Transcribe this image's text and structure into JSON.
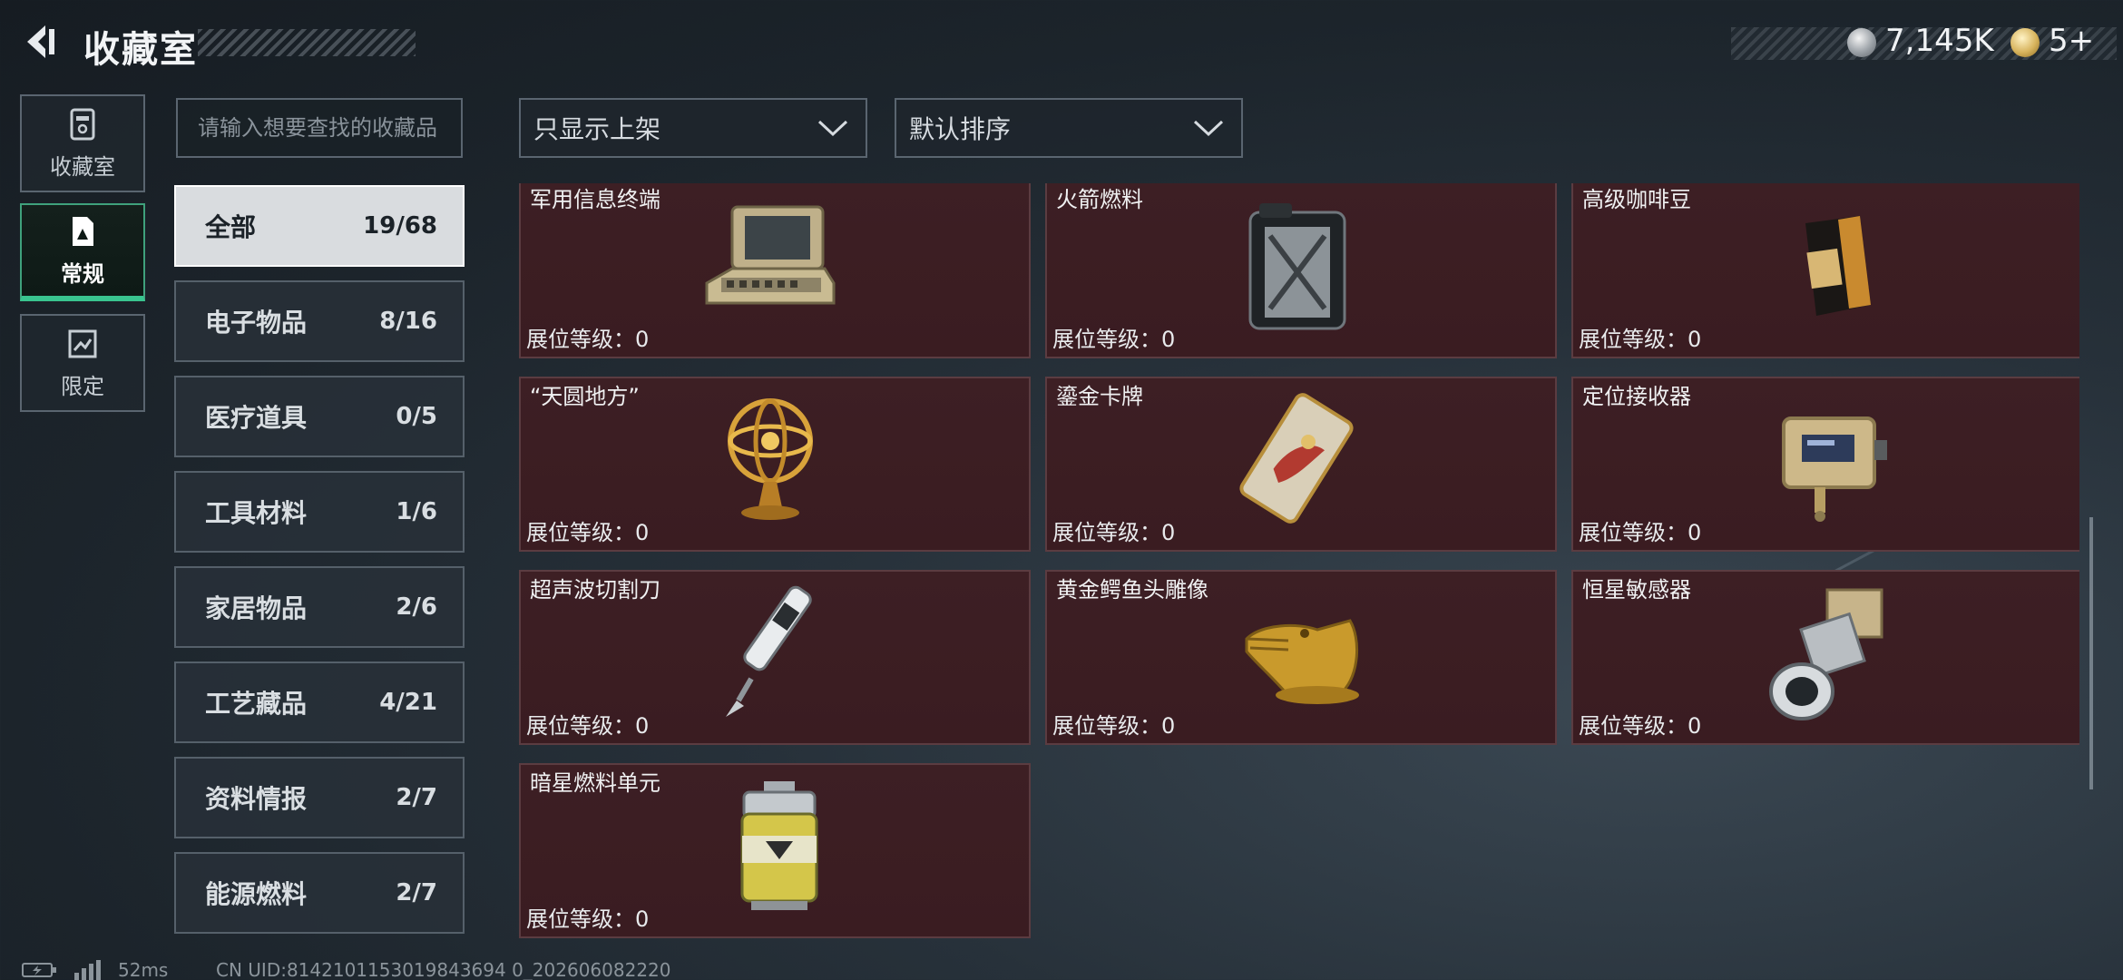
{
  "header": {
    "title": "收藏室"
  },
  "currency": {
    "silver": "7,145K",
    "gold": "5+"
  },
  "side_nav": [
    {
      "label": "收藏室",
      "icon": "collection-box-icon",
      "active": false
    },
    {
      "label": "常规",
      "icon": "regular-doc-icon",
      "active": true
    },
    {
      "label": "限定",
      "icon": "limited-card-icon",
      "active": false
    }
  ],
  "search": {
    "placeholder": "请输入想要查找的收藏品"
  },
  "filters": {
    "shelf": "只显示上架",
    "sort": "默认排序"
  },
  "categories": [
    {
      "name": "全部",
      "count": "19/68",
      "active": true
    },
    {
      "name": "电子物品",
      "count": "8/16"
    },
    {
      "name": "医疗道具",
      "count": "0/5"
    },
    {
      "name": "工具材料",
      "count": "1/6"
    },
    {
      "name": "家居物品",
      "count": "2/6"
    },
    {
      "name": "工艺藏品",
      "count": "4/21"
    },
    {
      "name": "资料情报",
      "count": "2/7"
    },
    {
      "name": "能源燃料",
      "count": "2/7"
    }
  ],
  "items": [
    {
      "name": "军用信息终端",
      "level": "展位等级：0",
      "icon": "military-terminal-icon"
    },
    {
      "name": "火箭燃料",
      "level": "展位等级：0",
      "icon": "fuel-canister-icon"
    },
    {
      "name": "高级咖啡豆",
      "level": "展位等级：0",
      "icon": "coffee-bag-icon"
    },
    {
      "name": "“天圆地方”",
      "level": "展位等级：0",
      "icon": "armillary-sphere-icon"
    },
    {
      "name": "鎏金卡牌",
      "level": "展位等级：0",
      "icon": "gilded-card-icon"
    },
    {
      "name": "定位接收器",
      "level": "展位等级：0",
      "icon": "gps-receiver-icon"
    },
    {
      "name": "超声波切割刀",
      "level": "展位等级：0",
      "icon": "ultrasonic-knife-icon"
    },
    {
      "name": "黄金鳄鱼头雕像",
      "level": "展位等级：0",
      "icon": "golden-crocodile-icon"
    },
    {
      "name": "恒星敏感器",
      "level": "展位等级：0",
      "icon": "star-sensor-icon"
    },
    {
      "name": "暗星燃料单元",
      "level": "展位等级：0",
      "icon": "fuel-cell-icon"
    }
  ],
  "status": {
    "ping": "52ms",
    "uid": "CN UID:8142101153019843694 0_202606082220"
  }
}
